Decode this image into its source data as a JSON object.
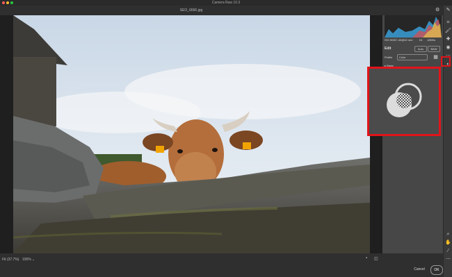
{
  "app": {
    "title": "Camera Raw 10.3",
    "filename": "SEO_6666.jpg"
  },
  "panel": {
    "meta": [
      "ISO 500",
      "17-40@40 mm",
      "f/4",
      "1/800s"
    ],
    "edit_label": "Edit",
    "auto_label": "Auto",
    "bw_label": "B&W",
    "profile_label": "Profile",
    "profile_value": "Color",
    "section_label": "Basic"
  },
  "footer": {
    "fit_label": "Fit (37.7%)",
    "zoom_value": "100%",
    "cancel_label": "Cancel",
    "ok_label": "OK"
  },
  "colors": {
    "highlight": "#e1141a",
    "panel_bg": "#474747",
    "toolbar_bg": "#3a3a3a"
  }
}
